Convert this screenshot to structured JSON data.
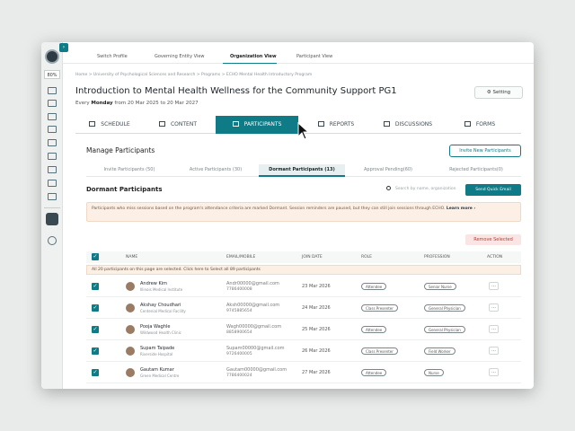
{
  "topnav": {
    "items": [
      "Switch Profile",
      "Governing Entity View",
      "Organization View",
      "Participant View"
    ]
  },
  "rail": {
    "percent": "80%"
  },
  "breadcrumb": "Home > University of Psychological Sciences and Research > Programs > ECHO Mental Health Introductory Program",
  "page": {
    "title": "Introduction to Mental Health Wellness for the Community Support PG1",
    "schedule_prefix": "Every",
    "schedule_day": "Monday",
    "schedule_range": "from 20 Mar 2025 to 20 Mar 2027",
    "setting_label": "Setting"
  },
  "tabs": [
    "SCHEDULE",
    "CONTENT",
    "PARTICIPANTS",
    "REPORTS",
    "DISCUSSIONS",
    "FORMS"
  ],
  "manage": {
    "title": "Manage Participants",
    "invite_label": "Invite New Participants",
    "subtabs": [
      "Invite Participants (50)",
      "Active Participants (30)",
      "Dormant Participants (13)",
      "Approval Pending(60)",
      "Rejected Participants(0)"
    ]
  },
  "dormant": {
    "title": "Dormant Participants",
    "search_placeholder": "Search by name, organization",
    "quick_email_label": "Send Quick Email",
    "info_text": "Participants who miss sessions based on the program's attendance criteria are marked Dormant. Session reminders are paused, but they can still join sessions through ECHO.",
    "learn_more": "Learn more ›",
    "remove_label": "Remove Selected",
    "columns": [
      "NAME",
      "EMAIL/MOBILE",
      "JOIN DATE",
      "ROLE",
      "PROFESSION",
      "ACTION"
    ],
    "select_all_text": "All 20 participants on this page are selected. Click here to Select all 89 participants"
  },
  "rows": [
    {
      "name": "Andrew Kim",
      "org": "Illinois Medical Institute",
      "email": "Andr00000@gmail.com",
      "phone": "7786400008",
      "date": "23 Mar 2026",
      "role": "Attendee",
      "profession": "Senior Nurse"
    },
    {
      "name": "Akshay Choudhari",
      "org": "Centenial Medical Facility",
      "email": "Aksh00000@gmail.com",
      "phone": "9745885654",
      "date": "24 Mar 2026",
      "role": "Class Presenter",
      "profession": "General Physician"
    },
    {
      "name": "Pooja Waghle",
      "org": "Wildwood Health Clinic",
      "email": "Wagh00000@gmail.com",
      "phone": "8858900654",
      "date": "25 Mar 2026",
      "role": "Attendee",
      "profession": "General Physician"
    },
    {
      "name": "Supam Taipade",
      "org": "Riverside Hospital",
      "email": "Supam00000@gmail.com",
      "phone": "9726400005",
      "date": "26 Mar 2026",
      "role": "Class Presenter",
      "profession": "Field Worker"
    },
    {
      "name": "Gautam Kumar",
      "org": "Green Medical Centre",
      "email": "Gautam00000@gmail.com",
      "phone": "7786400024",
      "date": "27 Mar 2026",
      "role": "Attendee",
      "profession": "Nurse"
    }
  ]
}
